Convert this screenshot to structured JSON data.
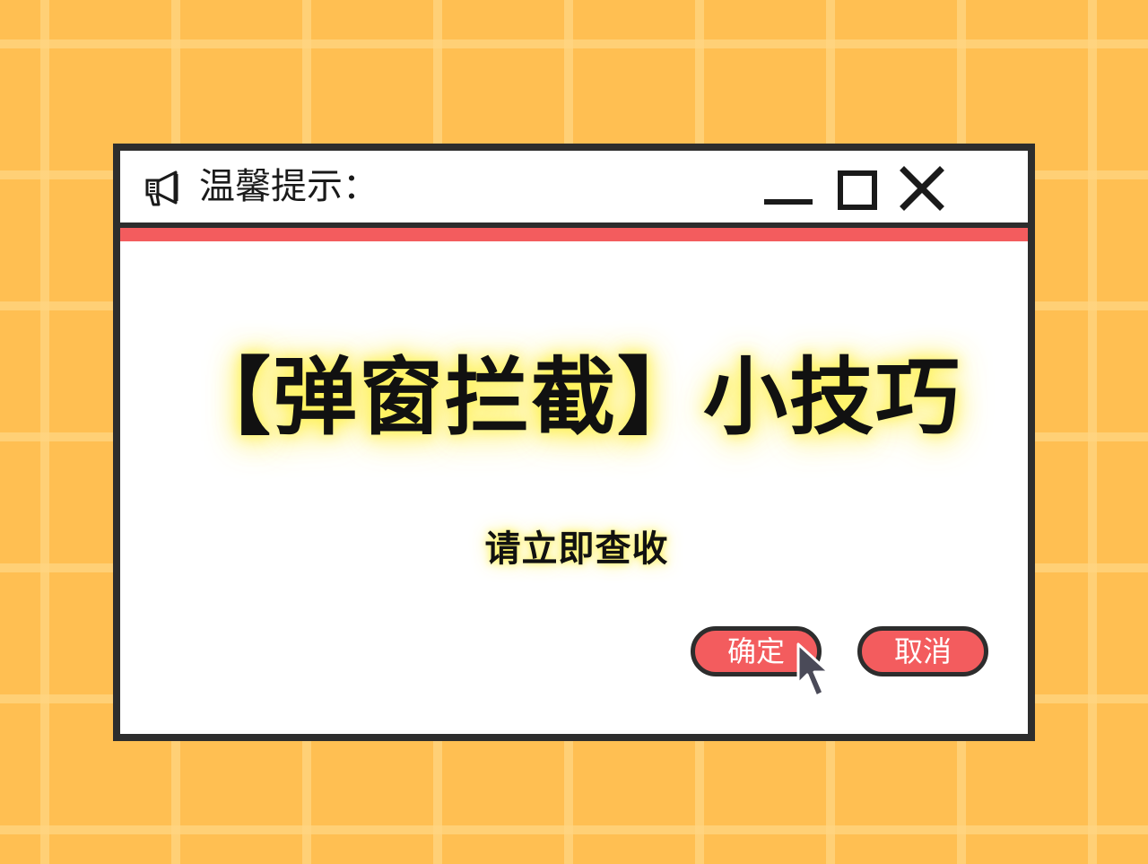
{
  "window": {
    "title": "温馨提示：",
    "title_icon": "megaphone-icon",
    "controls": {
      "minimize_icon": "minimize-icon",
      "maximize_icon": "maximize-icon",
      "close_icon": "close-icon"
    }
  },
  "content": {
    "headline": "【弹窗拦截】小技巧",
    "subtitle": "请立即查收"
  },
  "buttons": {
    "ok_label": "确定",
    "cancel_label": "取消"
  },
  "pointer": {
    "icon": "mouse-pointer-icon",
    "hovering": "ok-button"
  },
  "colors": {
    "background": "#FFBF52",
    "grid_lines": "#FFD682",
    "window_border": "#2D2D2D",
    "accent": "#F35C5E",
    "text_glow": "#FFF35A"
  }
}
